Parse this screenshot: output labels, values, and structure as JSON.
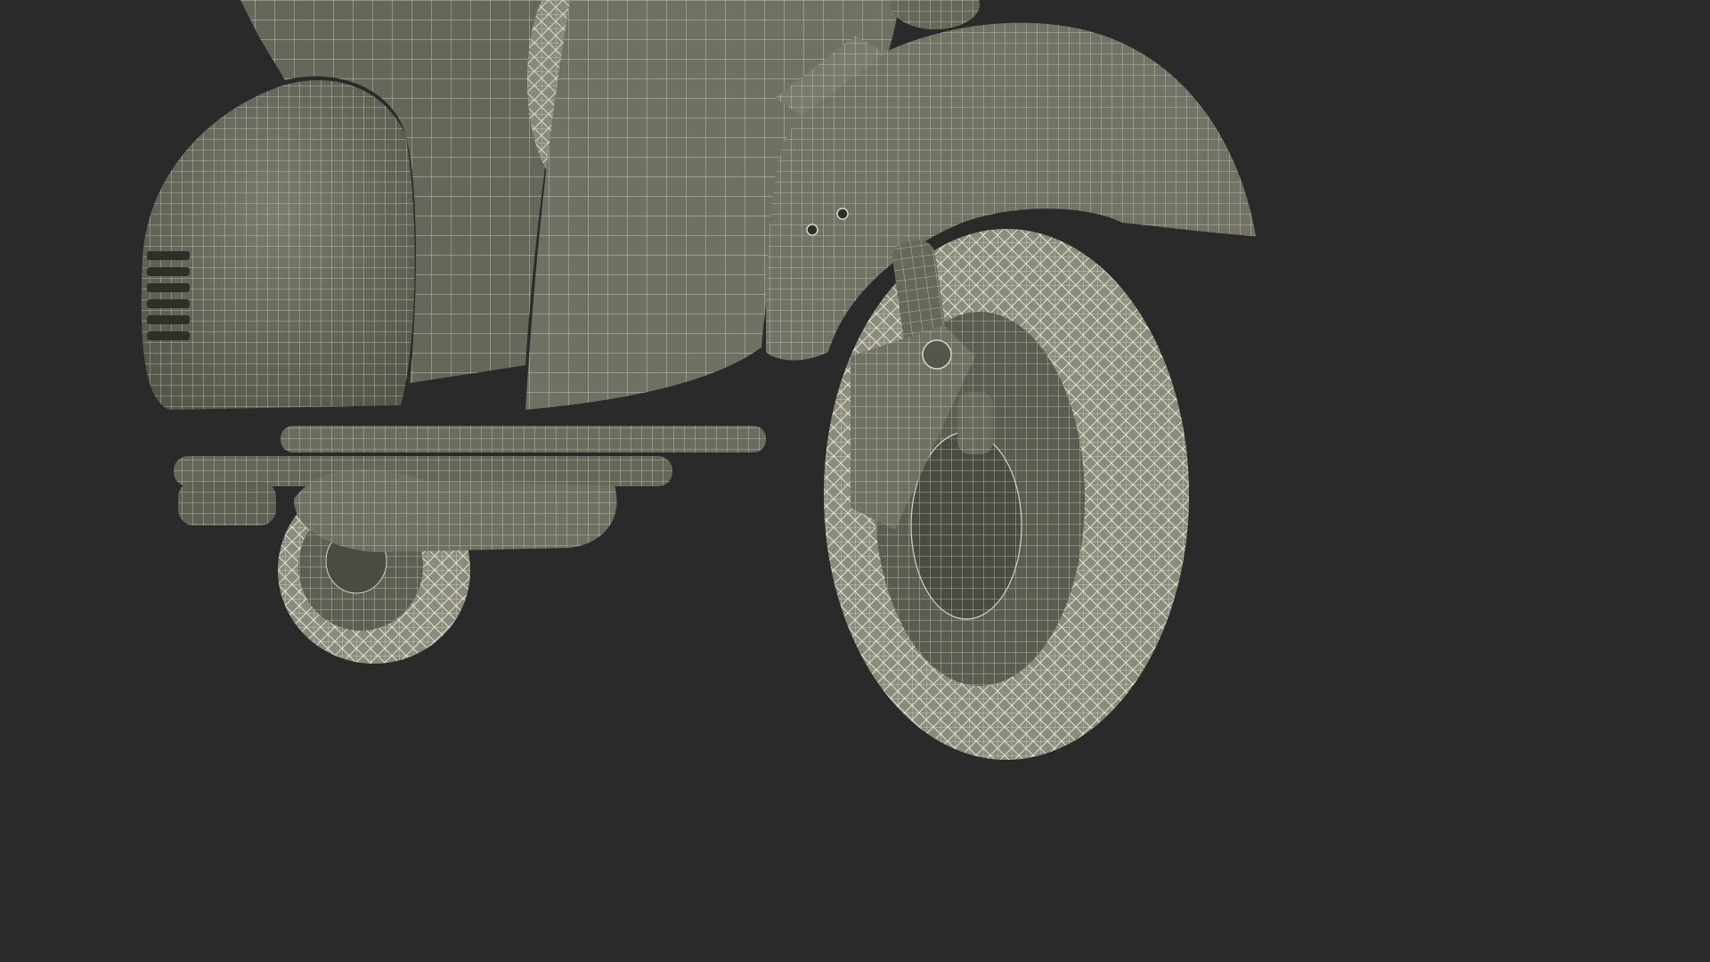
{
  "scene": {
    "subject": "scooter-wireframe-render",
    "colors": {
      "background": "#2a2a2a",
      "surface": "#6e6f62",
      "surface_dark": "#4f5046",
      "surface_light": "#8a8b7e",
      "wire": "#d6d7c4",
      "tire": "#8c8c7e",
      "tire_shadow": "#3a3a34"
    }
  }
}
